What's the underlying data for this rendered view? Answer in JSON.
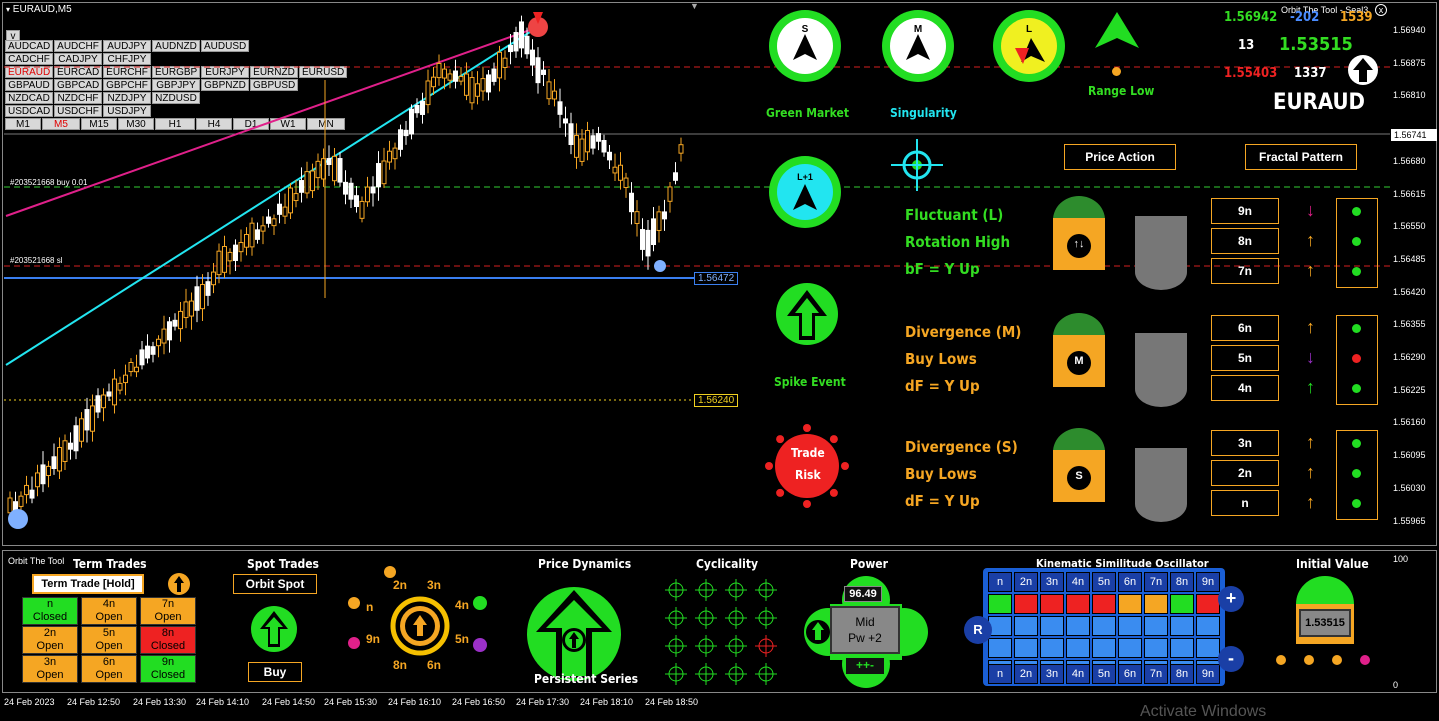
{
  "window": {
    "symbol_title": "EURAUD,M5",
    "chart_title_right": "Orbit The Tool - Seal3",
    "close_glyph": "x"
  },
  "symbol_buttons": [
    [
      "AUDCAD",
      "AUDCHF",
      "AUDJPY",
      "AUDNZD",
      "AUDUSD"
    ],
    [
      "CADCHF",
      "CADJPY",
      "CHFJPY"
    ],
    [
      "EURAUD",
      "EURCAD",
      "EURCHF",
      "EURGBP",
      "EURJPY",
      "EURNZD",
      "EURUSD"
    ],
    [
      "GBPAUD",
      "GBPCAD",
      "GBPCHF",
      "GBPJPY",
      "GBPNZD",
      "GBPUSD"
    ],
    [
      "NZDCAD",
      "NZDCHF",
      "NZDJPY",
      "NZDUSD"
    ],
    [
      "USDCAD",
      "USDCHF",
      "USDJPY"
    ]
  ],
  "collapse_label": "v",
  "timeframes": [
    "M1",
    "M5",
    "M15",
    "M30",
    "H1",
    "H4",
    "D1",
    "W1",
    "MN"
  ],
  "active_timeframe": "M5",
  "active_symbol": "EURAUD",
  "order_labels": {
    "buy": "#203521668 buy 0.01",
    "sl": "#203521668 sl"
  },
  "price_tags": {
    "sl": "1.56472",
    "low": "1.56240",
    "current": "1.56741"
  },
  "price_axis": [
    "1.56940",
    "1.56875",
    "1.56810",
    "1.56741",
    "1.56680",
    "1.56615",
    "1.56550",
    "1.56485",
    "1.56420",
    "1.56355",
    "1.56290",
    "1.56225",
    "1.56160",
    "1.56095",
    "1.56030",
    "1.55965"
  ],
  "sub_axis": {
    "top": "100",
    "bottom": "0"
  },
  "time_axis": [
    "24 Feb 2023",
    "24 Feb 12:50",
    "24 Feb 13:30",
    "24 Feb 14:10",
    "24 Feb 14:50",
    "24 Feb 15:30",
    "24 Feb 16:10",
    "24 Feb 16:50",
    "24 Feb 17:30",
    "24 Feb 18:10",
    "24 Feb 18:50"
  ],
  "top_stats": {
    "v1": "1.56942",
    "v2": "-202",
    "v3": "1539",
    "v4": "13",
    "v5": "1.53515",
    "v6": "1.55403",
    "v7": "1337",
    "symbol": "EURAUD"
  },
  "gauges": {
    "s": "S",
    "m": "M",
    "l": "L",
    "lplus": "L+1",
    "green_market": "Green Market",
    "singularity": "Singularity",
    "range_low": "Range Low",
    "spike_event": "Spike Event",
    "trade_risk": [
      "Trade",
      "Risk"
    ]
  },
  "buttons": {
    "price_action": "Price Action",
    "fractal_pattern": "Fractal Pattern"
  },
  "groups": [
    {
      "lines": [
        "Fluctuant (L)",
        "Rotation High",
        "bF = Y Up"
      ],
      "color": "#33dd22",
      "badge": "↑↓",
      "rows": [
        {
          "n": "9n",
          "arrow": "↓",
          "acolor": "#e0208a",
          "dot": "#22dd22"
        },
        {
          "n": "8n",
          "arrow": "↑",
          "acolor": "#f5a623",
          "dot": "#22dd22"
        },
        {
          "n": "7n",
          "arrow": "↑",
          "acolor": "#f5a623",
          "dot": "#22dd22"
        }
      ]
    },
    {
      "lines": [
        "Divergence (M)",
        "Buy Lows",
        "dF = Y Up"
      ],
      "color": "#f5a623",
      "badge": "M",
      "rows": [
        {
          "n": "6n",
          "arrow": "↑",
          "acolor": "#f5a623",
          "dot": "#22dd22"
        },
        {
          "n": "5n",
          "arrow": "↓",
          "acolor": "#9b30c8",
          "dot": "#ee2222"
        },
        {
          "n": "4n",
          "arrow": "↑",
          "acolor": "#22dd22",
          "dot": "#22dd22"
        }
      ]
    },
    {
      "lines": [
        "Divergence (S)",
        "Buy Lows",
        "dF = Y Up"
      ],
      "color": "#f5a623",
      "badge": "S",
      "rows": [
        {
          "n": "3n",
          "arrow": "↑",
          "acolor": "#f5a623",
          "dot": "#22dd22"
        },
        {
          "n": "2n",
          "arrow": "↑",
          "acolor": "#f5a623",
          "dot": "#22dd22"
        },
        {
          "n": "n",
          "arrow": "↑",
          "acolor": "#f5a623",
          "dot": "#22dd22"
        }
      ]
    }
  ],
  "bottom": {
    "brand": "Orbit The Tool",
    "term_trades": {
      "title": "Term Trades",
      "hold_label": "Term Trade [Hold]",
      "cells": [
        {
          "n": "n",
          "s": "Closed",
          "c": "#22dd22"
        },
        {
          "n": "4n",
          "s": "Open",
          "c": "#f5a623"
        },
        {
          "n": "7n",
          "s": "Open",
          "c": "#f5a623"
        },
        {
          "n": "2n",
          "s": "Open",
          "c": "#f5a623"
        },
        {
          "n": "5n",
          "s": "Open",
          "c": "#f5a623"
        },
        {
          "n": "8n",
          "s": "Closed",
          "c": "#ee2222"
        },
        {
          "n": "3n",
          "s": "Open",
          "c": "#f5a623"
        },
        {
          "n": "6n",
          "s": "Open",
          "c": "#f5a623"
        },
        {
          "n": "9n",
          "s": "Closed",
          "c": "#22dd22"
        }
      ]
    },
    "spot": {
      "title": "Spot Trades",
      "label": "Orbit Spot",
      "buy": "Buy"
    },
    "cycle": {
      "labels": [
        "2n",
        "3n",
        "4n",
        "5n",
        "6n",
        "8n",
        "9n",
        "n"
      ]
    },
    "price_dynamics": {
      "title": "Price Dynamics",
      "caption": "Persistent Series"
    },
    "cyclicality": {
      "title": "Cyclicality"
    },
    "power": {
      "title": "Power",
      "value": "96.49",
      "l1": "Mid",
      "l2": "Pw +2",
      "pm": "++-"
    },
    "kinematic": {
      "title": "Kinematic Similitude Oscillator",
      "headers": [
        "n",
        "2n",
        "3n",
        "4n",
        "5n",
        "6n",
        "7n",
        "8n",
        "9n"
      ],
      "row_colors": [
        "#22dd22",
        "#ee2222",
        "#ee2222",
        "#ee2222",
        "#ee2222",
        "#f5a623",
        "#f5a623",
        "#22dd22",
        "#ee2222"
      ],
      "left": "R",
      "plus": "+",
      "minus": "-"
    },
    "initial": {
      "title": "Initial Value",
      "value": "1.53515"
    }
  },
  "watermark": "Activate Windows",
  "colors": {
    "green": "#22dd22",
    "orange": "#f5a623",
    "red": "#ee2222",
    "cyan": "#22e5f0",
    "magenta": "#e0208a"
  }
}
